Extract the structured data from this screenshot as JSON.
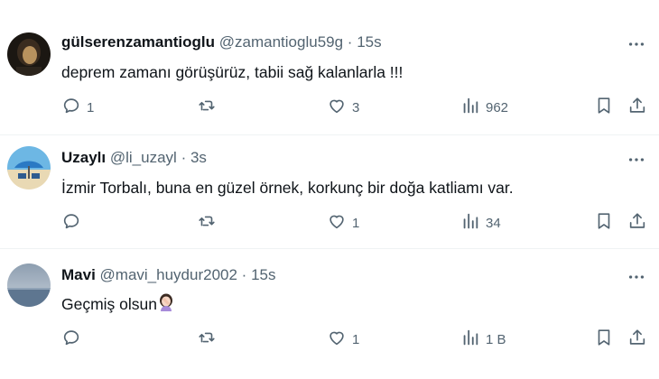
{
  "tweets": [
    {
      "name": "gülserenzamantioglu",
      "handle": "@zamantioglu59g",
      "separator": "·",
      "time": "15s",
      "text": "deprem zamanı  görüşürüz, tabii sağ kalanlarla  !!!",
      "stats": {
        "replies": "1",
        "retweets": "",
        "likes": "3",
        "views": "962"
      }
    },
    {
      "name": "Uzaylı",
      "handle": "@li_uzayl",
      "separator": "·",
      "time": "3s",
      "text": "İzmir Torbalı, buna en güzel örnek, korkunç bir doğa katliamı var.",
      "stats": {
        "replies": "",
        "retweets": "",
        "likes": "1",
        "views": "34"
      }
    },
    {
      "name": "Mavi",
      "handle": "@mavi_huydur2002",
      "separator": "·",
      "time": "15s",
      "text": "Geçmiş olsun",
      "emoji": "woman-facepalming-emoji",
      "stats": {
        "replies": "",
        "retweets": "",
        "likes": "1",
        "views": "1 B"
      }
    }
  ],
  "icons": {
    "reply": "reply-icon",
    "retweet": "retweet-icon",
    "like": "heart-icon",
    "views": "views-icon",
    "bookmark": "bookmark-icon",
    "share": "share-icon",
    "more": "more-icon"
  },
  "colors": {
    "text": "#0f1419",
    "secondary": "#536471",
    "divider": "#eff3f4"
  }
}
